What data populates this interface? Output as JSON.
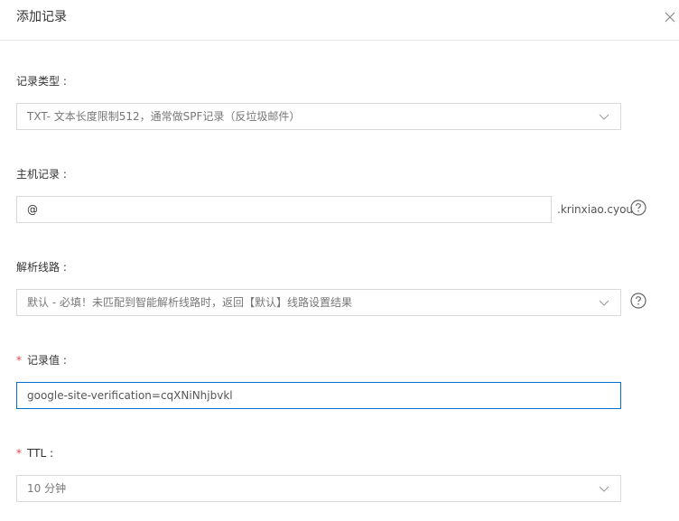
{
  "dialog": {
    "title": "添加记录"
  },
  "record_type": {
    "label": "记录类型 :",
    "value": "TXT- 文本长度限制512，通常做SPF记录（反垃圾邮件）"
  },
  "host_record": {
    "label": "主机记录 :",
    "value": "@",
    "domain_suffix": ".krinxiao.cyou"
  },
  "resolution_line": {
    "label": "解析线路 :",
    "value": "默认 - 必填！未匹配到智能解析线路时，返回【默认】线路设置结果"
  },
  "record_value": {
    "required_mark": "*",
    "label": "记录值 :",
    "value": "google-site-verification=cqXNiNhjbvkl"
  },
  "ttl": {
    "required_mark": "*",
    "label": "TTL :",
    "value": "10 分钟"
  },
  "colors": {
    "border": "#d9d9d9",
    "focus_border": "#0070cc",
    "required": "#e0484d"
  }
}
